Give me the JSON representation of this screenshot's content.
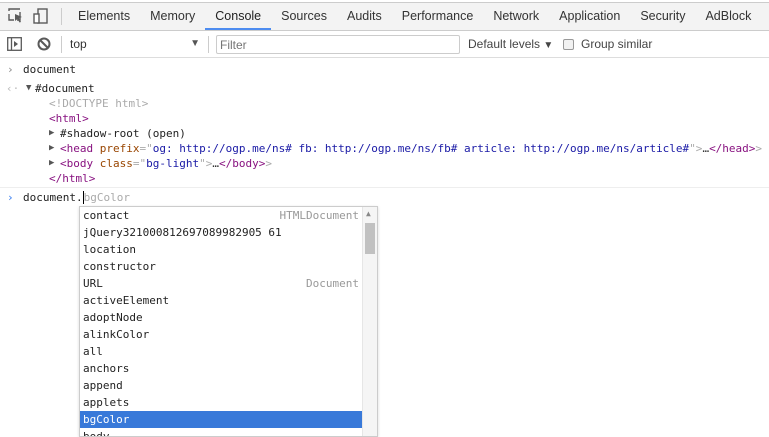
{
  "tabs": [
    "Elements",
    "Memory",
    "Console",
    "Sources",
    "Audits",
    "Performance",
    "Network",
    "Application",
    "Security",
    "AdBlock"
  ],
  "active_tab": "Console",
  "toolbar": {
    "context": "top",
    "filter_placeholder": "Filter",
    "levels": "Default levels",
    "group_similar": "Group similar",
    "group_similar_checked": false
  },
  "console": {
    "input1": "document",
    "result_root": "#document",
    "doctype": "<!DOCTYPE html>",
    "html_open": "<html>",
    "shadow_root": "#shadow-root (open)",
    "head": {
      "tag": "<head",
      "attr": "prefix",
      "value": "og: http://ogp.me/ns# fb: http://ogp.me/ns/fb# article: http://ogp.me/ns/article#",
      "close": "</head>"
    },
    "body": {
      "tag": "<body",
      "attr": "class",
      "value": "bg-light",
      "close": "</body>"
    },
    "html_close": "</html>",
    "prompt_text": "document.",
    "prompt_suggestion": "bgColor"
  },
  "autocomplete": {
    "items": [
      {
        "label": "contact",
        "type": "HTMLDocument"
      },
      {
        "label": "jQuery321000812697089982905 61",
        "type": ""
      },
      {
        "label": "location",
        "type": ""
      },
      {
        "label": "constructor",
        "type": ""
      },
      {
        "label": "URL",
        "type": "Document"
      },
      {
        "label": "activeElement",
        "type": ""
      },
      {
        "label": "adoptNode",
        "type": ""
      },
      {
        "label": "alinkColor",
        "type": ""
      },
      {
        "label": "all",
        "type": ""
      },
      {
        "label": "anchors",
        "type": ""
      },
      {
        "label": "append",
        "type": ""
      },
      {
        "label": "applets",
        "type": ""
      },
      {
        "label": "bgColor",
        "type": ""
      },
      {
        "label": "body",
        "type": ""
      }
    ],
    "selected": "bgColor",
    "selection_color": "#3879d9"
  }
}
